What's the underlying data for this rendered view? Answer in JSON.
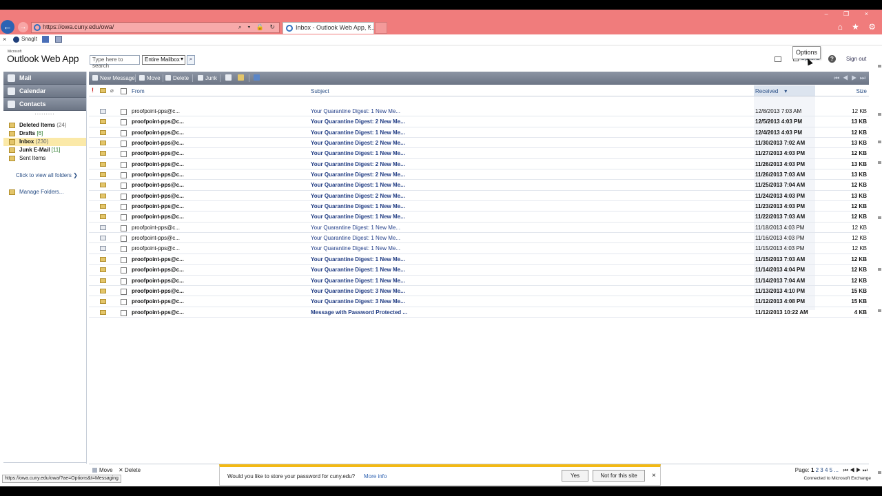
{
  "browser": {
    "address": "https://owa.cuny.edu/owa/",
    "tab_title": "Inbox - Outlook Web App, I...",
    "back_glyph": "←",
    "forward_glyph": "→",
    "address_tools": "⌕ ▾ 🔒 ↻",
    "tab_close": "×",
    "window_controls": "– ❐ ×",
    "chrome_icons": "⌂ ★ ⚙"
  },
  "snagit": {
    "close": "×",
    "label": "SnagIt"
  },
  "header": {
    "ms_label": "Microsoft",
    "app_title": "Outlook Web App",
    "search_placeholder": "Type here to search",
    "scope": "Entire Mailbox",
    "options": "Options",
    "help": "?",
    "sign_out": "Sign out",
    "tooltip": "Options"
  },
  "nav": {
    "modules": [
      "Mail",
      "Calendar",
      "Contacts"
    ],
    "dots": ".........",
    "folders": [
      {
        "name": "Deleted Items",
        "count": "(24)",
        "bold": true,
        "count_color": "gray"
      },
      {
        "name": "Drafts",
        "count": "[6]",
        "bold": true,
        "count_color": "green"
      },
      {
        "name": "Inbox",
        "count": "(230)",
        "bold": true,
        "count_color": "gray"
      },
      {
        "name": "Junk E-Mail",
        "count": "[11]",
        "bold": true,
        "count_color": "green"
      },
      {
        "name": "Sent Items",
        "count": "",
        "bold": false,
        "count_color": "gray"
      }
    ],
    "click_view": "Click to view all folders ❯",
    "manage": "Manage Folders..."
  },
  "toolbar": {
    "new_message": "New Message",
    "move": "Move",
    "delete": "Delete",
    "junk": "Junk",
    "pager": "⏮ ◀ ▶ ⏭"
  },
  "columns": {
    "flag": "!",
    "clip": "⌀",
    "from": "From",
    "subject": "Subject",
    "received": "Received",
    "sort": "▾",
    "size": "Size"
  },
  "messages": [
    {
      "from": "proofpoint-pps@c...",
      "subject": "Your Quarantine Digest: 1 New Me...",
      "received": "12/8/2013 7:03 AM",
      "size": "12 KB",
      "unread": false
    },
    {
      "from": "proofpoint-pps@c...",
      "subject": "Your Quarantine Digest: 2 New Me...",
      "received": "12/5/2013 4:03 PM",
      "size": "13 KB",
      "unread": true
    },
    {
      "from": "proofpoint-pps@c...",
      "subject": "Your Quarantine Digest: 1 New Me...",
      "received": "12/4/2013 4:03 PM",
      "size": "12 KB",
      "unread": true
    },
    {
      "from": "proofpoint-pps@c...",
      "subject": "Your Quarantine Digest: 2 New Me...",
      "received": "11/30/2013 7:02 AM",
      "size": "13 KB",
      "unread": true
    },
    {
      "from": "proofpoint-pps@c...",
      "subject": "Your Quarantine Digest: 1 New Me...",
      "received": "11/27/2013 4:03 PM",
      "size": "12 KB",
      "unread": true
    },
    {
      "from": "proofpoint-pps@c...",
      "subject": "Your Quarantine Digest: 2 New Me...",
      "received": "11/26/2013 4:03 PM",
      "size": "13 KB",
      "unread": true
    },
    {
      "from": "proofpoint-pps@c...",
      "subject": "Your Quarantine Digest: 2 New Me...",
      "received": "11/26/2013 7:03 AM",
      "size": "13 KB",
      "unread": true
    },
    {
      "from": "proofpoint-pps@c...",
      "subject": "Your Quarantine Digest: 1 New Me...",
      "received": "11/25/2013 7:04 AM",
      "size": "12 KB",
      "unread": true
    },
    {
      "from": "proofpoint-pps@c...",
      "subject": "Your Quarantine Digest: 2 New Me...",
      "received": "11/24/2013 4:03 PM",
      "size": "13 KB",
      "unread": true
    },
    {
      "from": "proofpoint-pps@c...",
      "subject": "Your Quarantine Digest: 1 New Me...",
      "received": "11/23/2013 4:03 PM",
      "size": "12 KB",
      "unread": true
    },
    {
      "from": "proofpoint-pps@c...",
      "subject": "Your Quarantine Digest: 1 New Me...",
      "received": "11/22/2013 7:03 AM",
      "size": "12 KB",
      "unread": true
    },
    {
      "from": "proofpoint-pps@c...",
      "subject": "Your Quarantine Digest: 1 New Me...",
      "received": "11/18/2013 4:03 PM",
      "size": "12 KB",
      "unread": false
    },
    {
      "from": "proofpoint-pps@c...",
      "subject": "Your Quarantine Digest: 1 New Me...",
      "received": "11/16/2013 4:03 PM",
      "size": "12 KB",
      "unread": false
    },
    {
      "from": "proofpoint-pps@c...",
      "subject": "Your Quarantine Digest: 1 New Me...",
      "received": "11/15/2013 4:03 PM",
      "size": "12 KB",
      "unread": false
    },
    {
      "from": "proofpoint-pps@c...",
      "subject": "Your Quarantine Digest: 1 New Me...",
      "received": "11/15/2013 7:03 AM",
      "size": "12 KB",
      "unread": true
    },
    {
      "from": "proofpoint-pps@c...",
      "subject": "Your Quarantine Digest: 1 New Me...",
      "received": "11/14/2013 4:04 PM",
      "size": "12 KB",
      "unread": true
    },
    {
      "from": "proofpoint-pps@c...",
      "subject": "Your Quarantine Digest: 1 New Me...",
      "received": "11/14/2013 7:04 AM",
      "size": "12 KB",
      "unread": true
    },
    {
      "from": "proofpoint-pps@c...",
      "subject": "Your Quarantine Digest: 3 New Me...",
      "received": "11/13/2013 4:10 PM",
      "size": "15 KB",
      "unread": true
    },
    {
      "from": "proofpoint-pps@c...",
      "subject": "Your Quarantine Digest: 3 New Me...",
      "received": "11/12/2013 4:08 PM",
      "size": "15 KB",
      "unread": true
    },
    {
      "from": "proofpoint-pps@c...",
      "subject": "Message with Password Protected ...",
      "received": "11/12/2013 10:22 AM",
      "size": "4 KB",
      "unread": true
    }
  ],
  "list_bottom": {
    "move": "Move",
    "delete": "Delete",
    "page_label": "Page:",
    "current_page": "1",
    "other_pages": "2 3 4 5 ...",
    "page_nav": "⏮ ◀ ▶ ⏭"
  },
  "password_bar": {
    "question": "Would you like to store your password for cuny.edu?",
    "more_info": "More info",
    "yes": "Yes",
    "not_for_site": "Not for this site",
    "close": "×"
  },
  "status": {
    "url": "https://owa.cuny.edu/owa/?ae=Options&t=Messaging",
    "connected": "Connected to Microsoft Exchange"
  }
}
